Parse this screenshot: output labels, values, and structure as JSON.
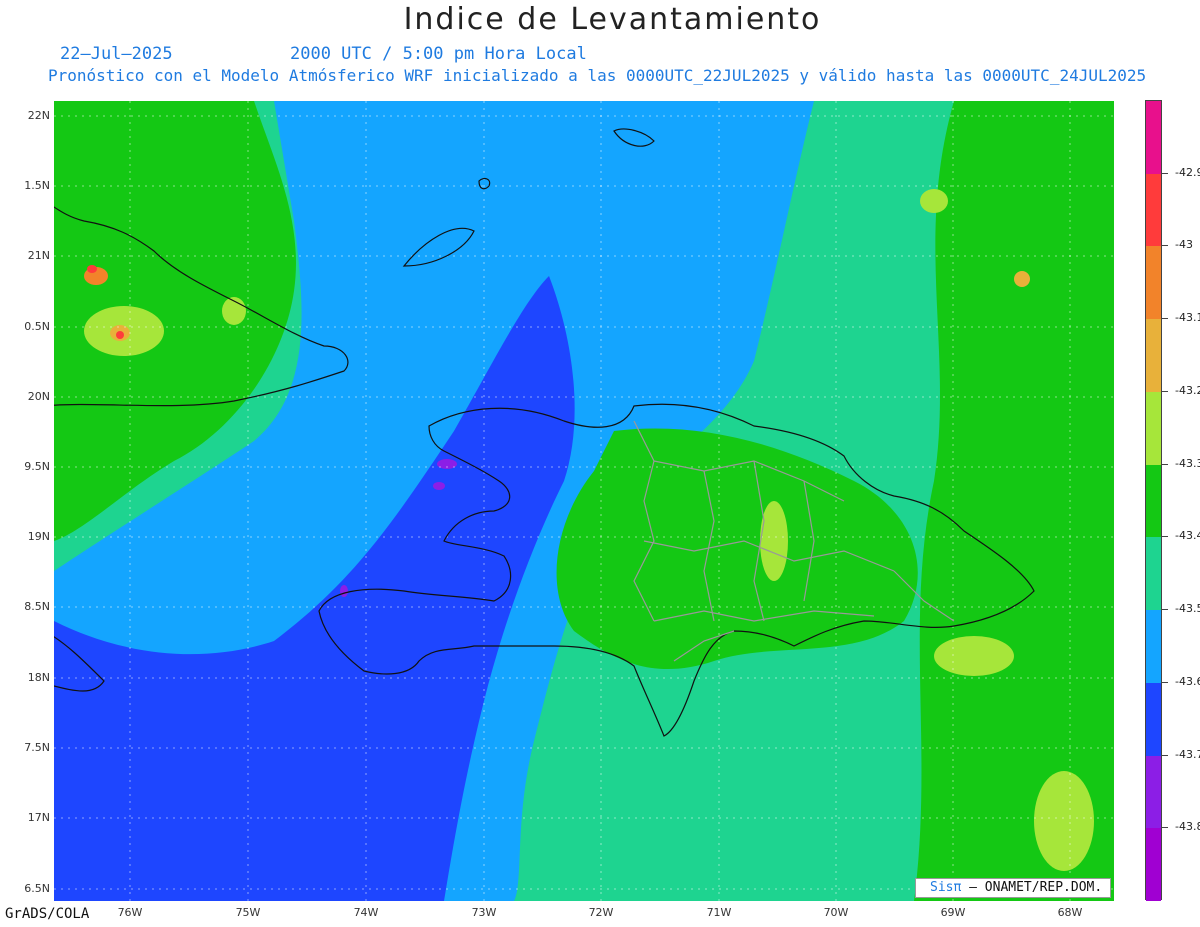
{
  "header": {
    "title": "Indice de Levantamiento",
    "date": "22–Jul–2025",
    "time": "2000 UTC / 5:00 pm Hora Local",
    "description": "Pronóstico con el Modelo Atmósferico WRF inicializado a las 0000UTC_22JUL2025 y válido hasta las  0000UTC_24JUL2025"
  },
  "axes": {
    "y_labels": [
      "22N",
      "1.5N",
      "21N",
      "0.5N",
      "20N",
      "9.5N",
      "19N",
      "8.5N",
      "18N",
      "7.5N",
      "17N",
      "6.5N"
    ],
    "x_labels": [
      "76W",
      "75W",
      "74W",
      "73W",
      "72W",
      "71W",
      "70W",
      "69W",
      "68W"
    ]
  },
  "colorbar": {
    "labels": [
      "-42.9",
      "-43",
      "-43.1",
      "-43.2",
      "-43.3",
      "-43.4",
      "-43.5",
      "-43.6",
      "-43.7",
      "-43.8"
    ],
    "colors": [
      "#e8108c",
      "#ff3b3b",
      "#f2832a",
      "#e8b13a",
      "#a6e63a",
      "#14c814",
      "#1ed490",
      "#14a5ff",
      "#1e46ff",
      "#8c1ee6",
      "#a000d2"
    ]
  },
  "map_colors": {
    "green": "#14c814",
    "teal": "#1ed490",
    "light_blue": "#14a5ff",
    "blue": "#1e46ff",
    "violet": "#8c1ee6",
    "yellow_green": "#a6e63a"
  },
  "credits": {
    "left": "GrADS/COLA",
    "box_brand": "Sisπ",
    "box_text": "– ONAMET/REP.DOM."
  }
}
